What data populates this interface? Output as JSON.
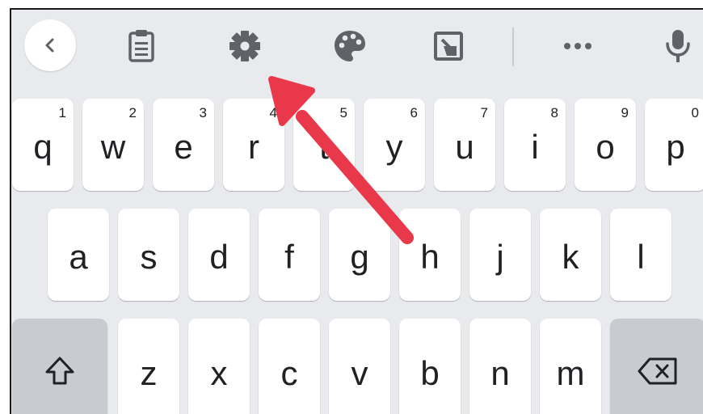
{
  "toolbar": {
    "icons": [
      "back-chevron",
      "clipboard",
      "settings-gear",
      "theme-palette",
      "resize-handle",
      "more-dots",
      "microphone"
    ]
  },
  "colors": {
    "keyboard_bg": "#e8eaed",
    "key_bg": "#ffffff",
    "function_key_bg": "#c8cbd0",
    "icon": "#5f6368",
    "annotation_arrow": "#e8384a"
  },
  "rows": [
    [
      {
        "label": "q",
        "hint": "1"
      },
      {
        "label": "w",
        "hint": "2"
      },
      {
        "label": "e",
        "hint": "3"
      },
      {
        "label": "r",
        "hint": "4"
      },
      {
        "label": "t",
        "hint": "5"
      },
      {
        "label": "y",
        "hint": "6"
      },
      {
        "label": "u",
        "hint": "7"
      },
      {
        "label": "i",
        "hint": "8"
      },
      {
        "label": "o",
        "hint": "9"
      },
      {
        "label": "p",
        "hint": "0"
      }
    ],
    [
      {
        "label": "a"
      },
      {
        "label": "s"
      },
      {
        "label": "d"
      },
      {
        "label": "f"
      },
      {
        "label": "g"
      },
      {
        "label": "h"
      },
      {
        "label": "j"
      },
      {
        "label": "k"
      },
      {
        "label": "l"
      }
    ],
    [
      {
        "label": "z"
      },
      {
        "label": "x"
      },
      {
        "label": "c"
      },
      {
        "label": "v"
      },
      {
        "label": "b"
      },
      {
        "label": "n"
      },
      {
        "label": "m"
      }
    ]
  ],
  "function_keys": {
    "shift_icon": "shift-arrow-up",
    "backspace_icon": "backspace-x"
  },
  "annotation": {
    "type": "arrow",
    "points_to": "settings-gear"
  }
}
